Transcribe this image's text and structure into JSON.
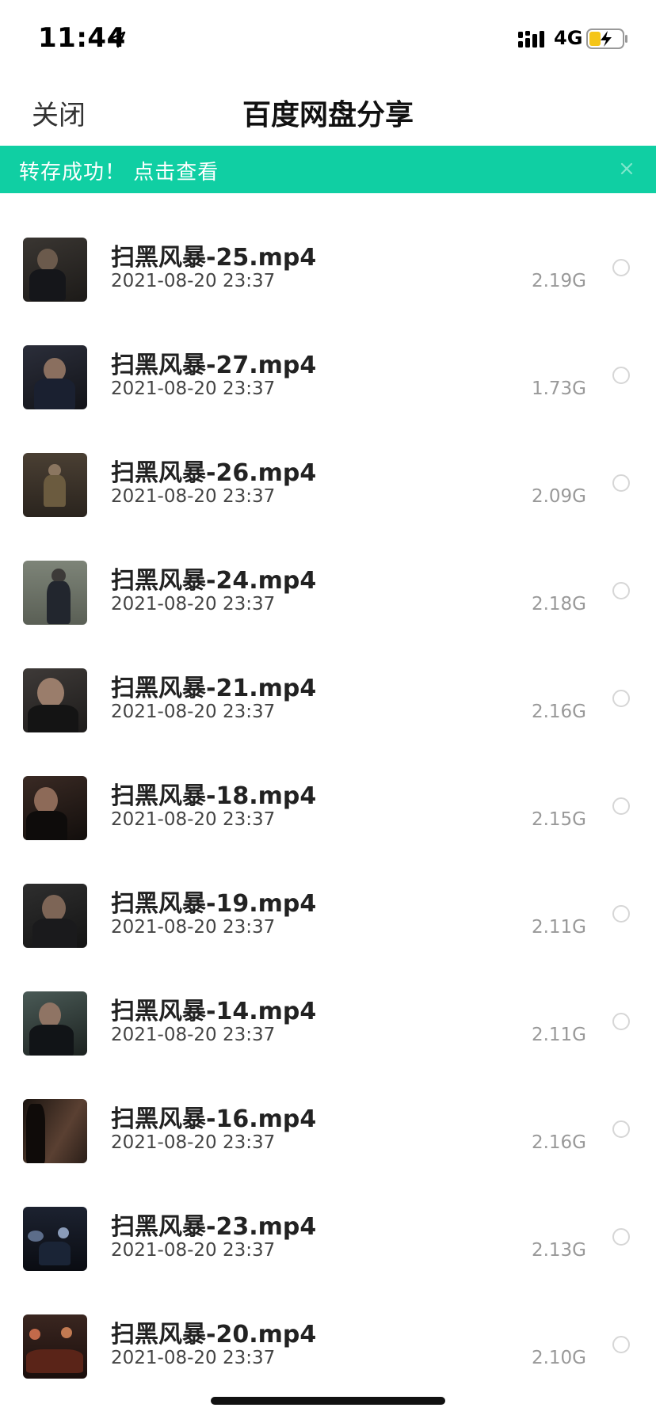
{
  "status_bar": {
    "time": "11:44",
    "network": "4G",
    "icons": [
      "location-arrow-icon",
      "cellular-signal-icon",
      "battery-charging-icon"
    ],
    "battery_color": "#f5c518"
  },
  "nav": {
    "close_label": "关闭",
    "title": "百度网盘分享"
  },
  "banner": {
    "text": "转存成功！ 点击查看",
    "bg_color": "#10cfa3",
    "close_icon": "close-icon"
  },
  "files": [
    {
      "name": "扫黑风暴-25.mp4",
      "date": "2021-08-20 23:37",
      "size": "2.19G"
    },
    {
      "name": "扫黑风暴-27.mp4",
      "date": "2021-08-20 23:37",
      "size": "1.73G"
    },
    {
      "name": "扫黑风暴-26.mp4",
      "date": "2021-08-20 23:37",
      "size": "2.09G"
    },
    {
      "name": "扫黑风暴-24.mp4",
      "date": "2021-08-20 23:37",
      "size": "2.18G"
    },
    {
      "name": "扫黑风暴-21.mp4",
      "date": "2021-08-20 23:37",
      "size": "2.16G"
    },
    {
      "name": "扫黑风暴-18.mp4",
      "date": "2021-08-20 23:37",
      "size": "2.15G"
    },
    {
      "name": "扫黑风暴-19.mp4",
      "date": "2021-08-20 23:37",
      "size": "2.11G"
    },
    {
      "name": "扫黑风暴-14.mp4",
      "date": "2021-08-20 23:37",
      "size": "2.11G"
    },
    {
      "name": "扫黑风暴-16.mp4",
      "date": "2021-08-20 23:37",
      "size": "2.16G"
    },
    {
      "name": "扫黑风暴-23.mp4",
      "date": "2021-08-20 23:37",
      "size": "2.13G"
    },
    {
      "name": "扫黑风暴-20.mp4",
      "date": "2021-08-20 23:37",
      "size": "2.10G"
    }
  ]
}
